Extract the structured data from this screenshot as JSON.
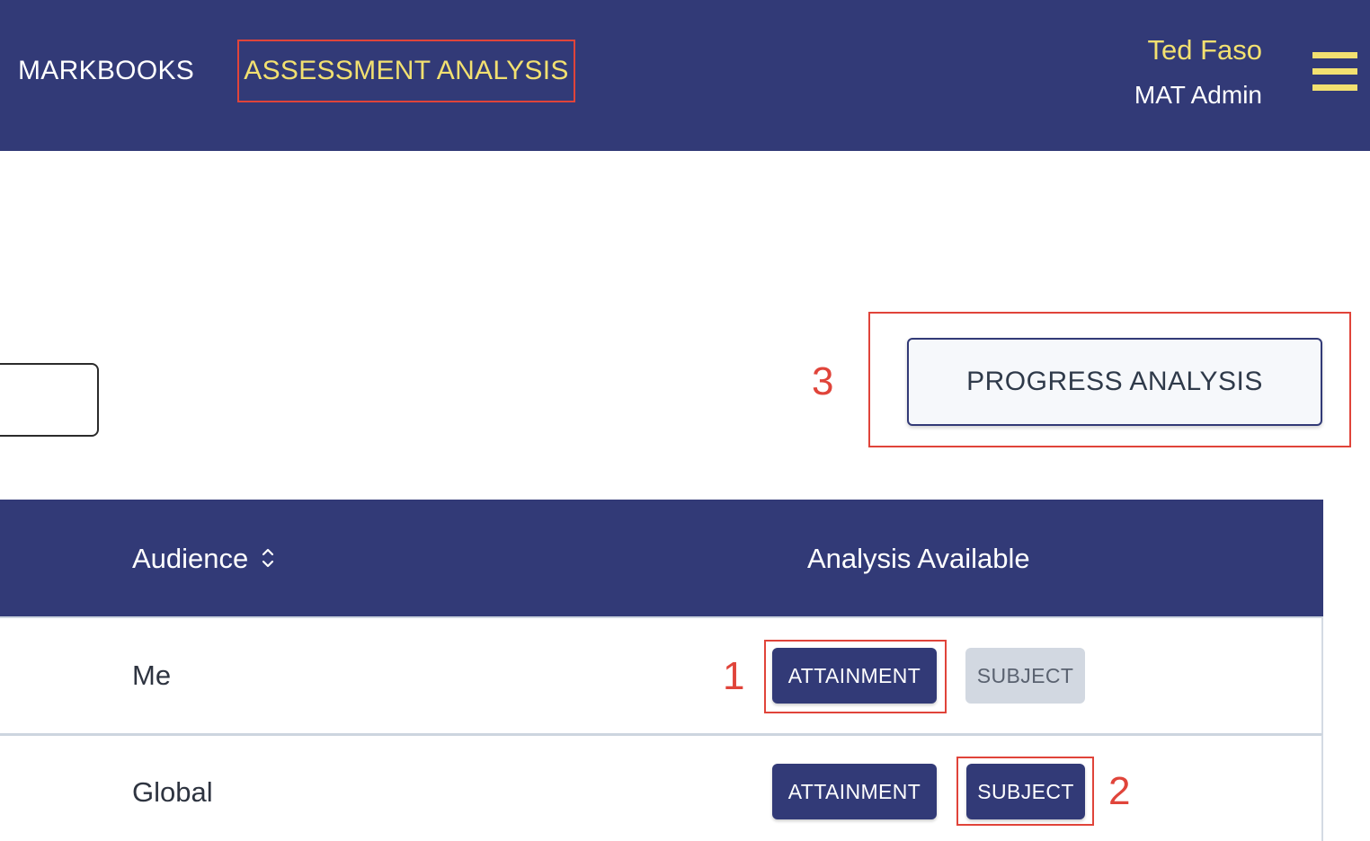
{
  "header": {
    "nav": {
      "markbooks": "MARKBOOKS",
      "assessment_analysis": "ASSESSMENT ANALYSIS"
    },
    "user": {
      "name": "Ted Faso",
      "role": "MAT Admin"
    },
    "menu_icon": "hamburger-menu-icon"
  },
  "controls": {
    "progress_analysis_label": "PROGRESS ANALYSIS"
  },
  "annotations": {
    "one": "1",
    "two": "2",
    "three": "3",
    "color": "#e0443a"
  },
  "table": {
    "headers": {
      "audience": "Audience",
      "analysis": "Analysis Available"
    },
    "rows": [
      {
        "audience": "Me",
        "attainment": "ATTAINMENT",
        "subject": "SUBJECT",
        "subject_state": "disabled"
      },
      {
        "audience": "Global",
        "attainment": "ATTAINMENT",
        "subject": "SUBJECT",
        "subject_state": "enabled"
      }
    ]
  },
  "colors": {
    "brand_navy": "#323a77",
    "accent_yellow": "#f2e070",
    "disabled_gray": "#d2d8e1"
  }
}
